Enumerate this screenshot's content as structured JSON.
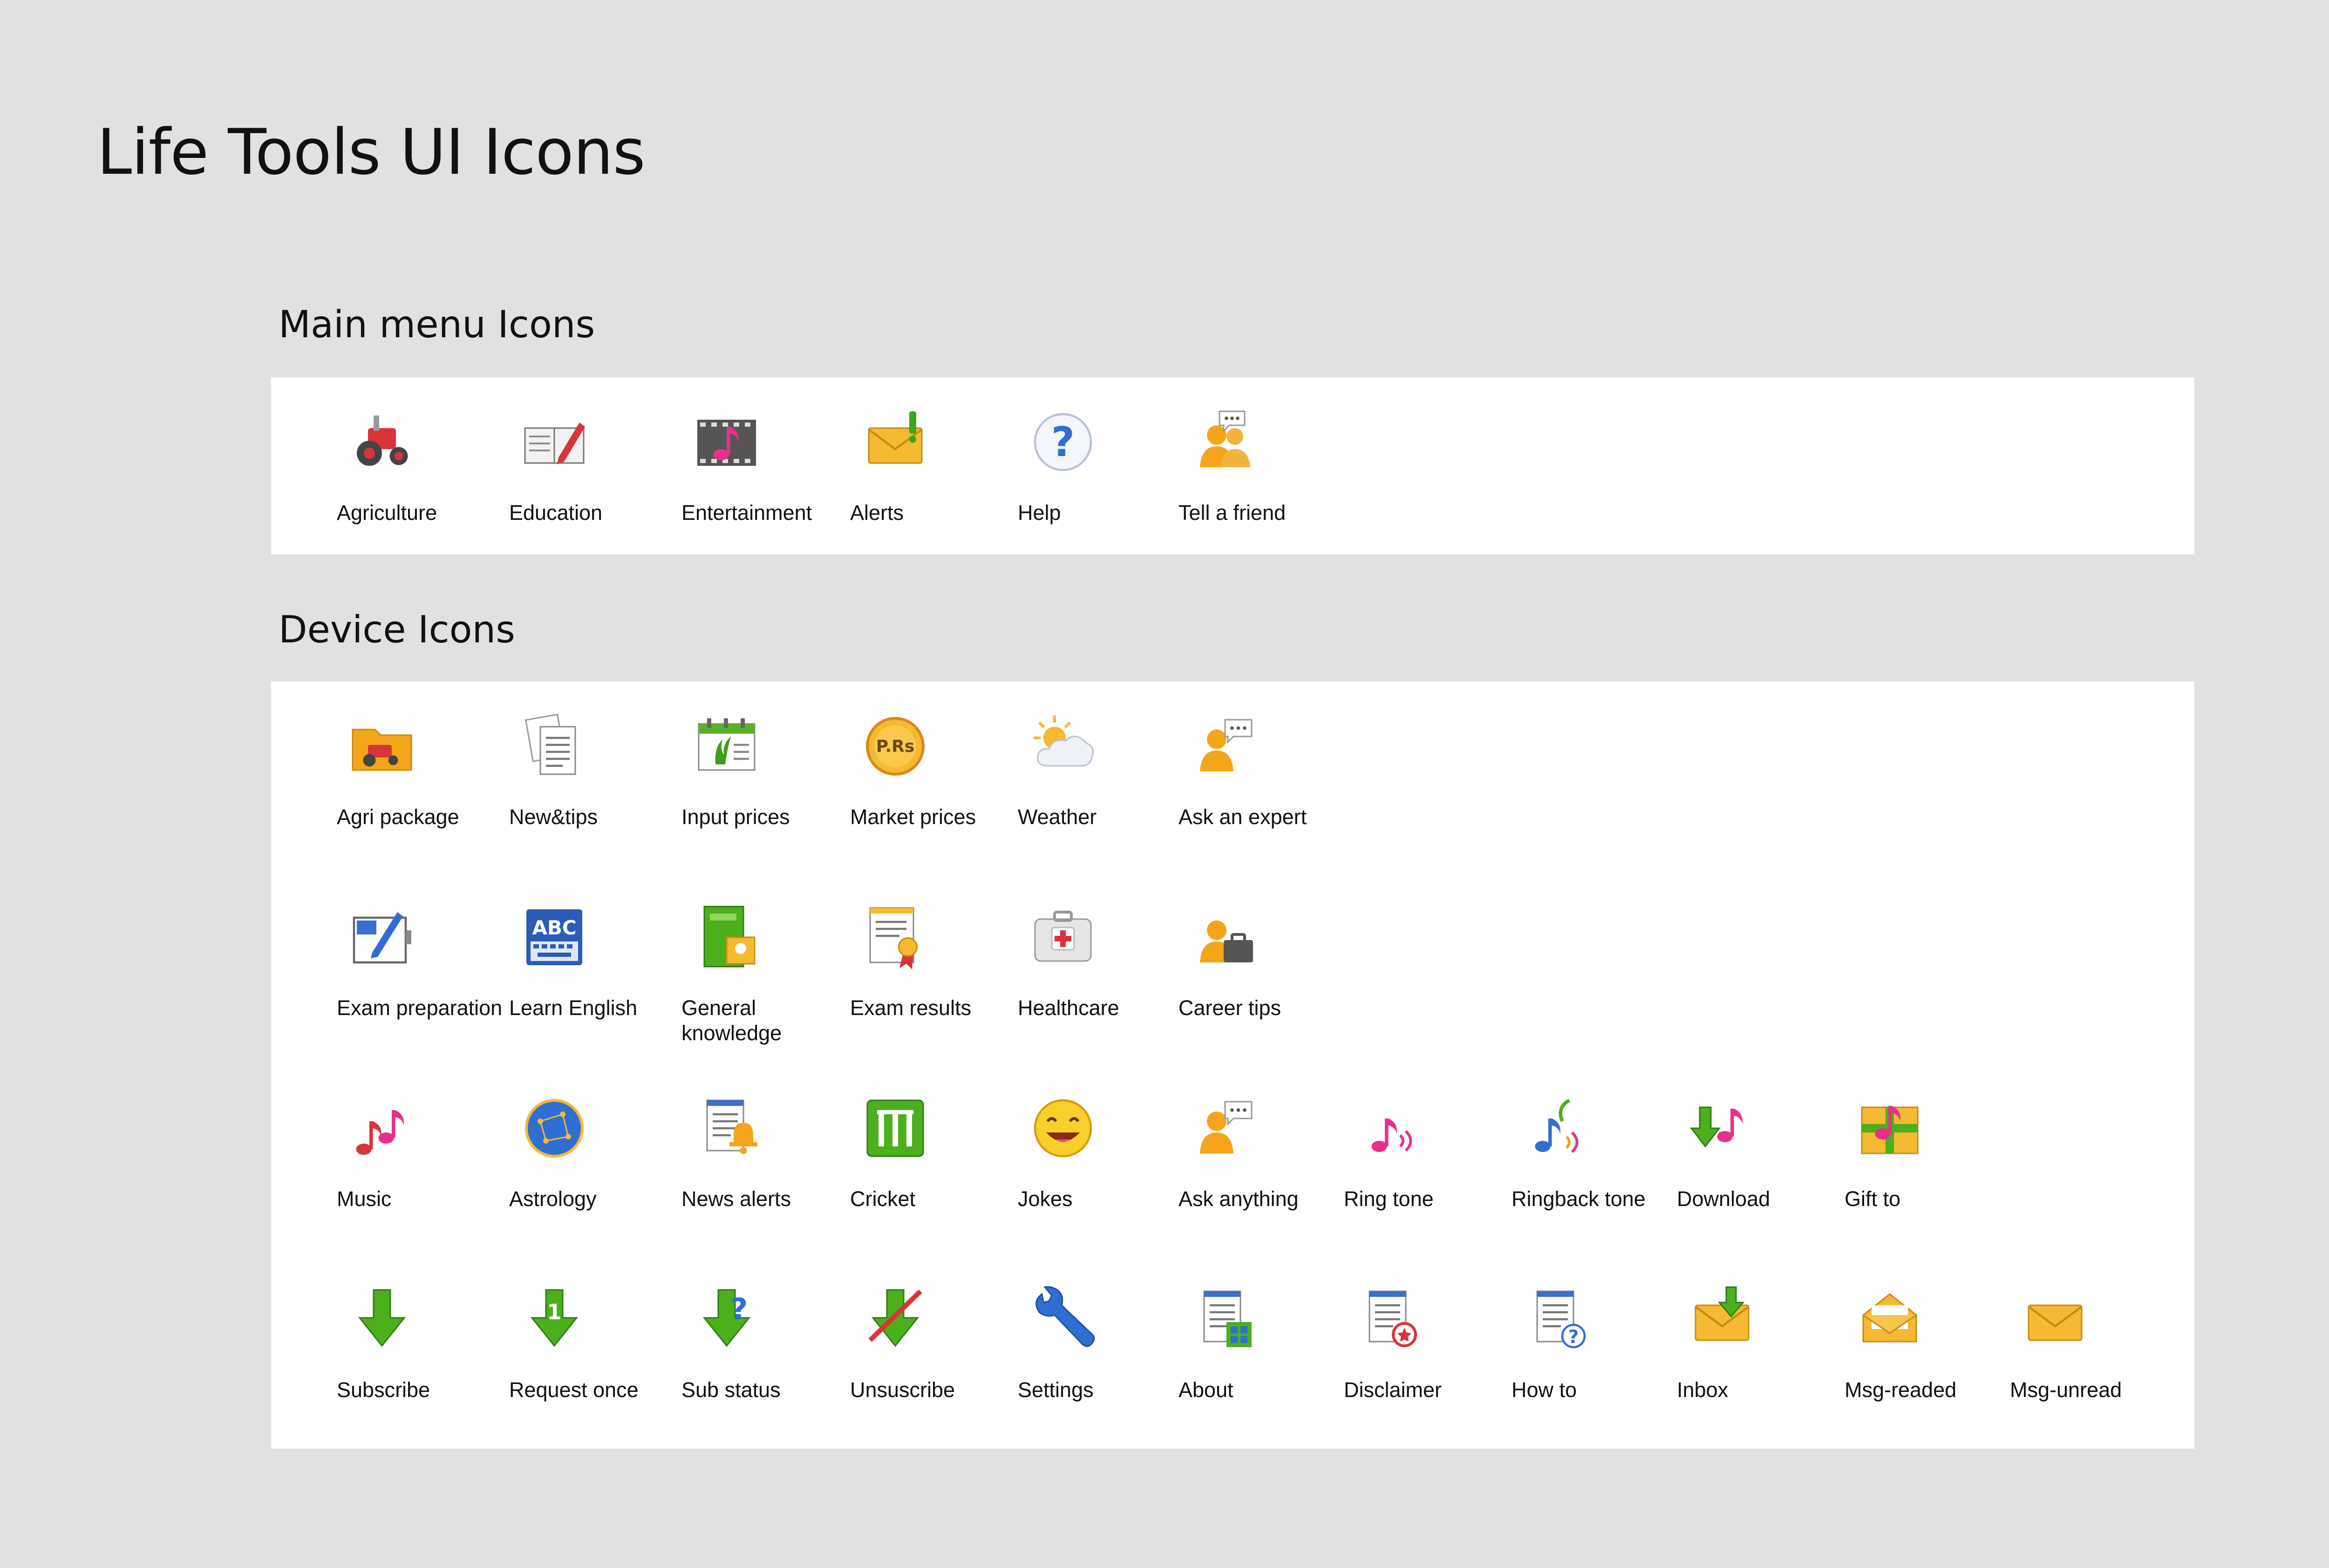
{
  "title": "Life Tools UI Icons",
  "sections": {
    "main": {
      "title": "Main menu Icons",
      "items": [
        {
          "label": "Agriculture",
          "icon": "tractor-icon"
        },
        {
          "label": "Education",
          "icon": "book-pencil-icon"
        },
        {
          "label": "Entertainment",
          "icon": "film-music-icon"
        },
        {
          "label": "Alerts",
          "icon": "envelope-alert-icon"
        },
        {
          "label": "Help",
          "icon": "question-icon"
        },
        {
          "label": "Tell a friend",
          "icon": "people-chat-icon"
        }
      ]
    },
    "device": {
      "title": "Device Icons",
      "rows": [
        [
          {
            "label": "Agri package",
            "icon": "folder-tractor-icon"
          },
          {
            "label": "New&tips",
            "icon": "documents-icon"
          },
          {
            "label": "Input prices",
            "icon": "calendar-plant-icon"
          },
          {
            "label": "Market prices",
            "icon": "coin-icon",
            "badge": "P.Rs"
          },
          {
            "label": "Weather",
            "icon": "sun-cloud-icon"
          },
          {
            "label": "Ask an expert",
            "icon": "person-chat-icon"
          }
        ],
        [
          {
            "label": "Exam preparation",
            "icon": "notebook-pen-icon"
          },
          {
            "label": "Learn English",
            "icon": "abc-keyboard-icon",
            "badge": "ABC"
          },
          {
            "label": "General knowledge",
            "icon": "green-book-icon"
          },
          {
            "label": "Exam results",
            "icon": "certificate-icon"
          },
          {
            "label": "Healthcare",
            "icon": "medkit-icon"
          },
          {
            "label": "Career tips",
            "icon": "person-briefcase-icon"
          }
        ],
        [
          {
            "label": "Music",
            "icon": "music-notes-icon"
          },
          {
            "label": "Astrology",
            "icon": "astrology-globe-icon"
          },
          {
            "label": "News alerts",
            "icon": "news-bell-icon"
          },
          {
            "label": "Cricket",
            "icon": "cricket-wicket-icon"
          },
          {
            "label": "Jokes",
            "icon": "smiley-icon"
          },
          {
            "label": "Ask anything",
            "icon": "person-chat-icon"
          },
          {
            "label": "Ring tone",
            "icon": "ringtone-icon"
          },
          {
            "label": "Ringback tone",
            "icon": "ringback-icon"
          },
          {
            "label": "Download",
            "icon": "download-music-icon"
          },
          {
            "label": "Gift to",
            "icon": "gift-music-icon"
          }
        ],
        [
          {
            "label": "Subscribe",
            "icon": "arrow-down-icon"
          },
          {
            "label": "Request once",
            "icon": "arrow-down-one-icon",
            "badge": "1"
          },
          {
            "label": "Sub status",
            "icon": "arrow-down-question-icon",
            "badge": "?"
          },
          {
            "label": "Unsuscribe",
            "icon": "arrow-down-cross-icon"
          },
          {
            "label": "Settings",
            "icon": "wrench-icon"
          },
          {
            "label": "About",
            "icon": "doc-grid-icon"
          },
          {
            "label": "Disclaimer",
            "icon": "doc-star-icon"
          },
          {
            "label": "How to",
            "icon": "doc-question-icon",
            "badge": "?"
          },
          {
            "label": "Inbox",
            "icon": "envelope-down-icon"
          },
          {
            "label": "Msg-readed",
            "icon": "envelope-open-icon"
          },
          {
            "label": "Msg-unread",
            "icon": "envelope-closed-icon"
          }
        ]
      ]
    }
  },
  "colors": {
    "background": "#e1e1e1",
    "panel": "#ffffff",
    "text": "#111111",
    "green": "#4caf1c",
    "orange": "#f5a51a",
    "red": "#d9343a",
    "blue": "#2f6fd3",
    "pink": "#e8308a"
  }
}
